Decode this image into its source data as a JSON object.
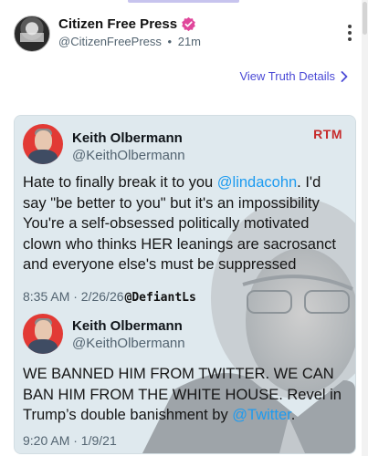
{
  "post": {
    "author_name": "Citizen Free Press",
    "author_handle": "@CitizenFreePress",
    "separator": "•",
    "time_ago": "21m",
    "view_details_label": "View Truth Details"
  },
  "card": {
    "badge": "RTM",
    "tweets": [
      {
        "name": "Keith Olbermann",
        "handle": "@KeithOlbermann",
        "body_before": "Hate to finally break it to you ",
        "mention": "@lindacohn",
        "body_after": ". I'd say \"be better to you\" but it's an impossibility You're a self-obsessed politically motivated clown who thinks HER leanings are sacrosanct and everyone else's must be suppressed",
        "timestamp": "8:35 AM · 2/26/26",
        "watermark": "@DefiantLs"
      },
      {
        "name": "Keith Olbermann",
        "handle": "@KeithOlbermann",
        "body_before": "WE BANNED HIM FROM TWITTER. WE CAN BAN HIM FROM THE WHITE HOUSE. Revel in Trump’s double banishment by ",
        "mention": "@Twitter",
        "body_after": ".",
        "timestamp": "9:20 AM · 1/9/21"
      }
    ]
  },
  "colors": {
    "accent": "#4b4ad6",
    "verified_badge": "#e0469b",
    "mention": "#1d9bf0",
    "rtm_red": "#c72b2b",
    "tweet_avatar_bg": "#e23a35"
  },
  "icons": {
    "verified": "verified-badge-icon",
    "more": "vertical-ellipsis-icon",
    "chevron": "chevron-right-icon"
  }
}
